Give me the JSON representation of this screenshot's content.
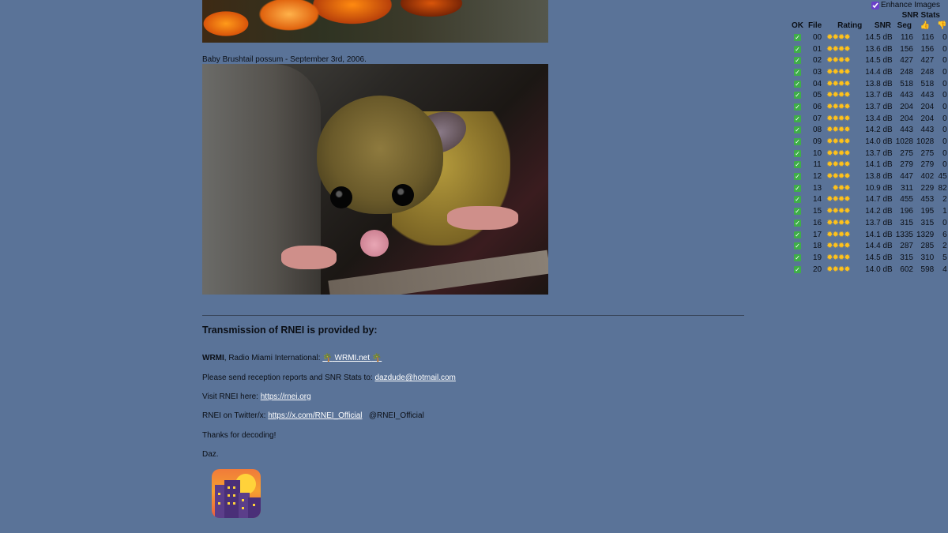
{
  "post": {
    "caption": "Baby Brushtail possum - September 3rd, 2006."
  },
  "footer": {
    "heading": "Transmission of RNEI is provided by:",
    "wrmi_name": "WRMI",
    "wrmi_text": ", Radio Miami International: ",
    "wrmi_link": "WRMI.net",
    "reports_text": "Please send reception reports and SNR Stats to: ",
    "reports_email": "dazdude@hotmail.com",
    "visit_text": "Visit RNEI here: ",
    "visit_link": "https://rnei.org",
    "twitter_text": "RNEI on Twitter/x: ",
    "twitter_link": "https://x.com/RNEI_Official",
    "twitter_handle": "@RNEI_Official",
    "thanks": "Thanks for decoding!",
    "signoff": "Daz."
  },
  "stats": {
    "enhance_label": "Enhance Images",
    "enhance_checked": true,
    "title": "SNR Stats",
    "headers": [
      "OK",
      "File",
      "Rating",
      "SNR",
      "Seg",
      "👍",
      "👎"
    ],
    "star_color": "#ffc21a",
    "rows": [
      {
        "file": "00",
        "stars": 4,
        "snr": "14.5 dB",
        "seg": "116",
        "up": "116",
        "down": "0"
      },
      {
        "file": "01",
        "stars": 4,
        "snr": "13.6 dB",
        "seg": "156",
        "up": "156",
        "down": "0"
      },
      {
        "file": "02",
        "stars": 4,
        "snr": "14.5 dB",
        "seg": "427",
        "up": "427",
        "down": "0"
      },
      {
        "file": "03",
        "stars": 4,
        "snr": "14.4 dB",
        "seg": "248",
        "up": "248",
        "down": "0"
      },
      {
        "file": "04",
        "stars": 4,
        "snr": "13.8 dB",
        "seg": "518",
        "up": "518",
        "down": "0"
      },
      {
        "file": "05",
        "stars": 4,
        "snr": "13.7 dB",
        "seg": "443",
        "up": "443",
        "down": "0"
      },
      {
        "file": "06",
        "stars": 4,
        "snr": "13.7 dB",
        "seg": "204",
        "up": "204",
        "down": "0"
      },
      {
        "file": "07",
        "stars": 4,
        "snr": "13.4 dB",
        "seg": "204",
        "up": "204",
        "down": "0"
      },
      {
        "file": "08",
        "stars": 4,
        "snr": "14.2 dB",
        "seg": "443",
        "up": "443",
        "down": "0"
      },
      {
        "file": "09",
        "stars": 4,
        "snr": "14.0 dB",
        "seg": "1028",
        "up": "1028",
        "down": "0"
      },
      {
        "file": "10",
        "stars": 4,
        "snr": "13.7 dB",
        "seg": "275",
        "up": "275",
        "down": "0"
      },
      {
        "file": "11",
        "stars": 4,
        "snr": "14.1 dB",
        "seg": "279",
        "up": "279",
        "down": "0"
      },
      {
        "file": "12",
        "stars": 4,
        "snr": "13.8 dB",
        "seg": "447",
        "up": "402",
        "down": "45"
      },
      {
        "file": "13",
        "stars": 3,
        "snr": "10.9 dB",
        "seg": "311",
        "up": "229",
        "down": "82"
      },
      {
        "file": "14",
        "stars": 4,
        "snr": "14.7 dB",
        "seg": "455",
        "up": "453",
        "down": "2"
      },
      {
        "file": "15",
        "stars": 4,
        "snr": "14.2 dB",
        "seg": "196",
        "up": "195",
        "down": "1"
      },
      {
        "file": "16",
        "stars": 4,
        "snr": "13.7 dB",
        "seg": "315",
        "up": "315",
        "down": "0"
      },
      {
        "file": "17",
        "stars": 4,
        "snr": "14.1 dB",
        "seg": "1335",
        "up": "1329",
        "down": "6"
      },
      {
        "file": "18",
        "stars": 4,
        "snr": "14.4 dB",
        "seg": "287",
        "up": "285",
        "down": "2"
      },
      {
        "file": "19",
        "stars": 4,
        "snr": "14.5 dB",
        "seg": "315",
        "up": "310",
        "down": "5"
      },
      {
        "file": "20",
        "stars": 4,
        "snr": "14.0 dB",
        "seg": "602",
        "up": "598",
        "down": "4"
      }
    ]
  }
}
